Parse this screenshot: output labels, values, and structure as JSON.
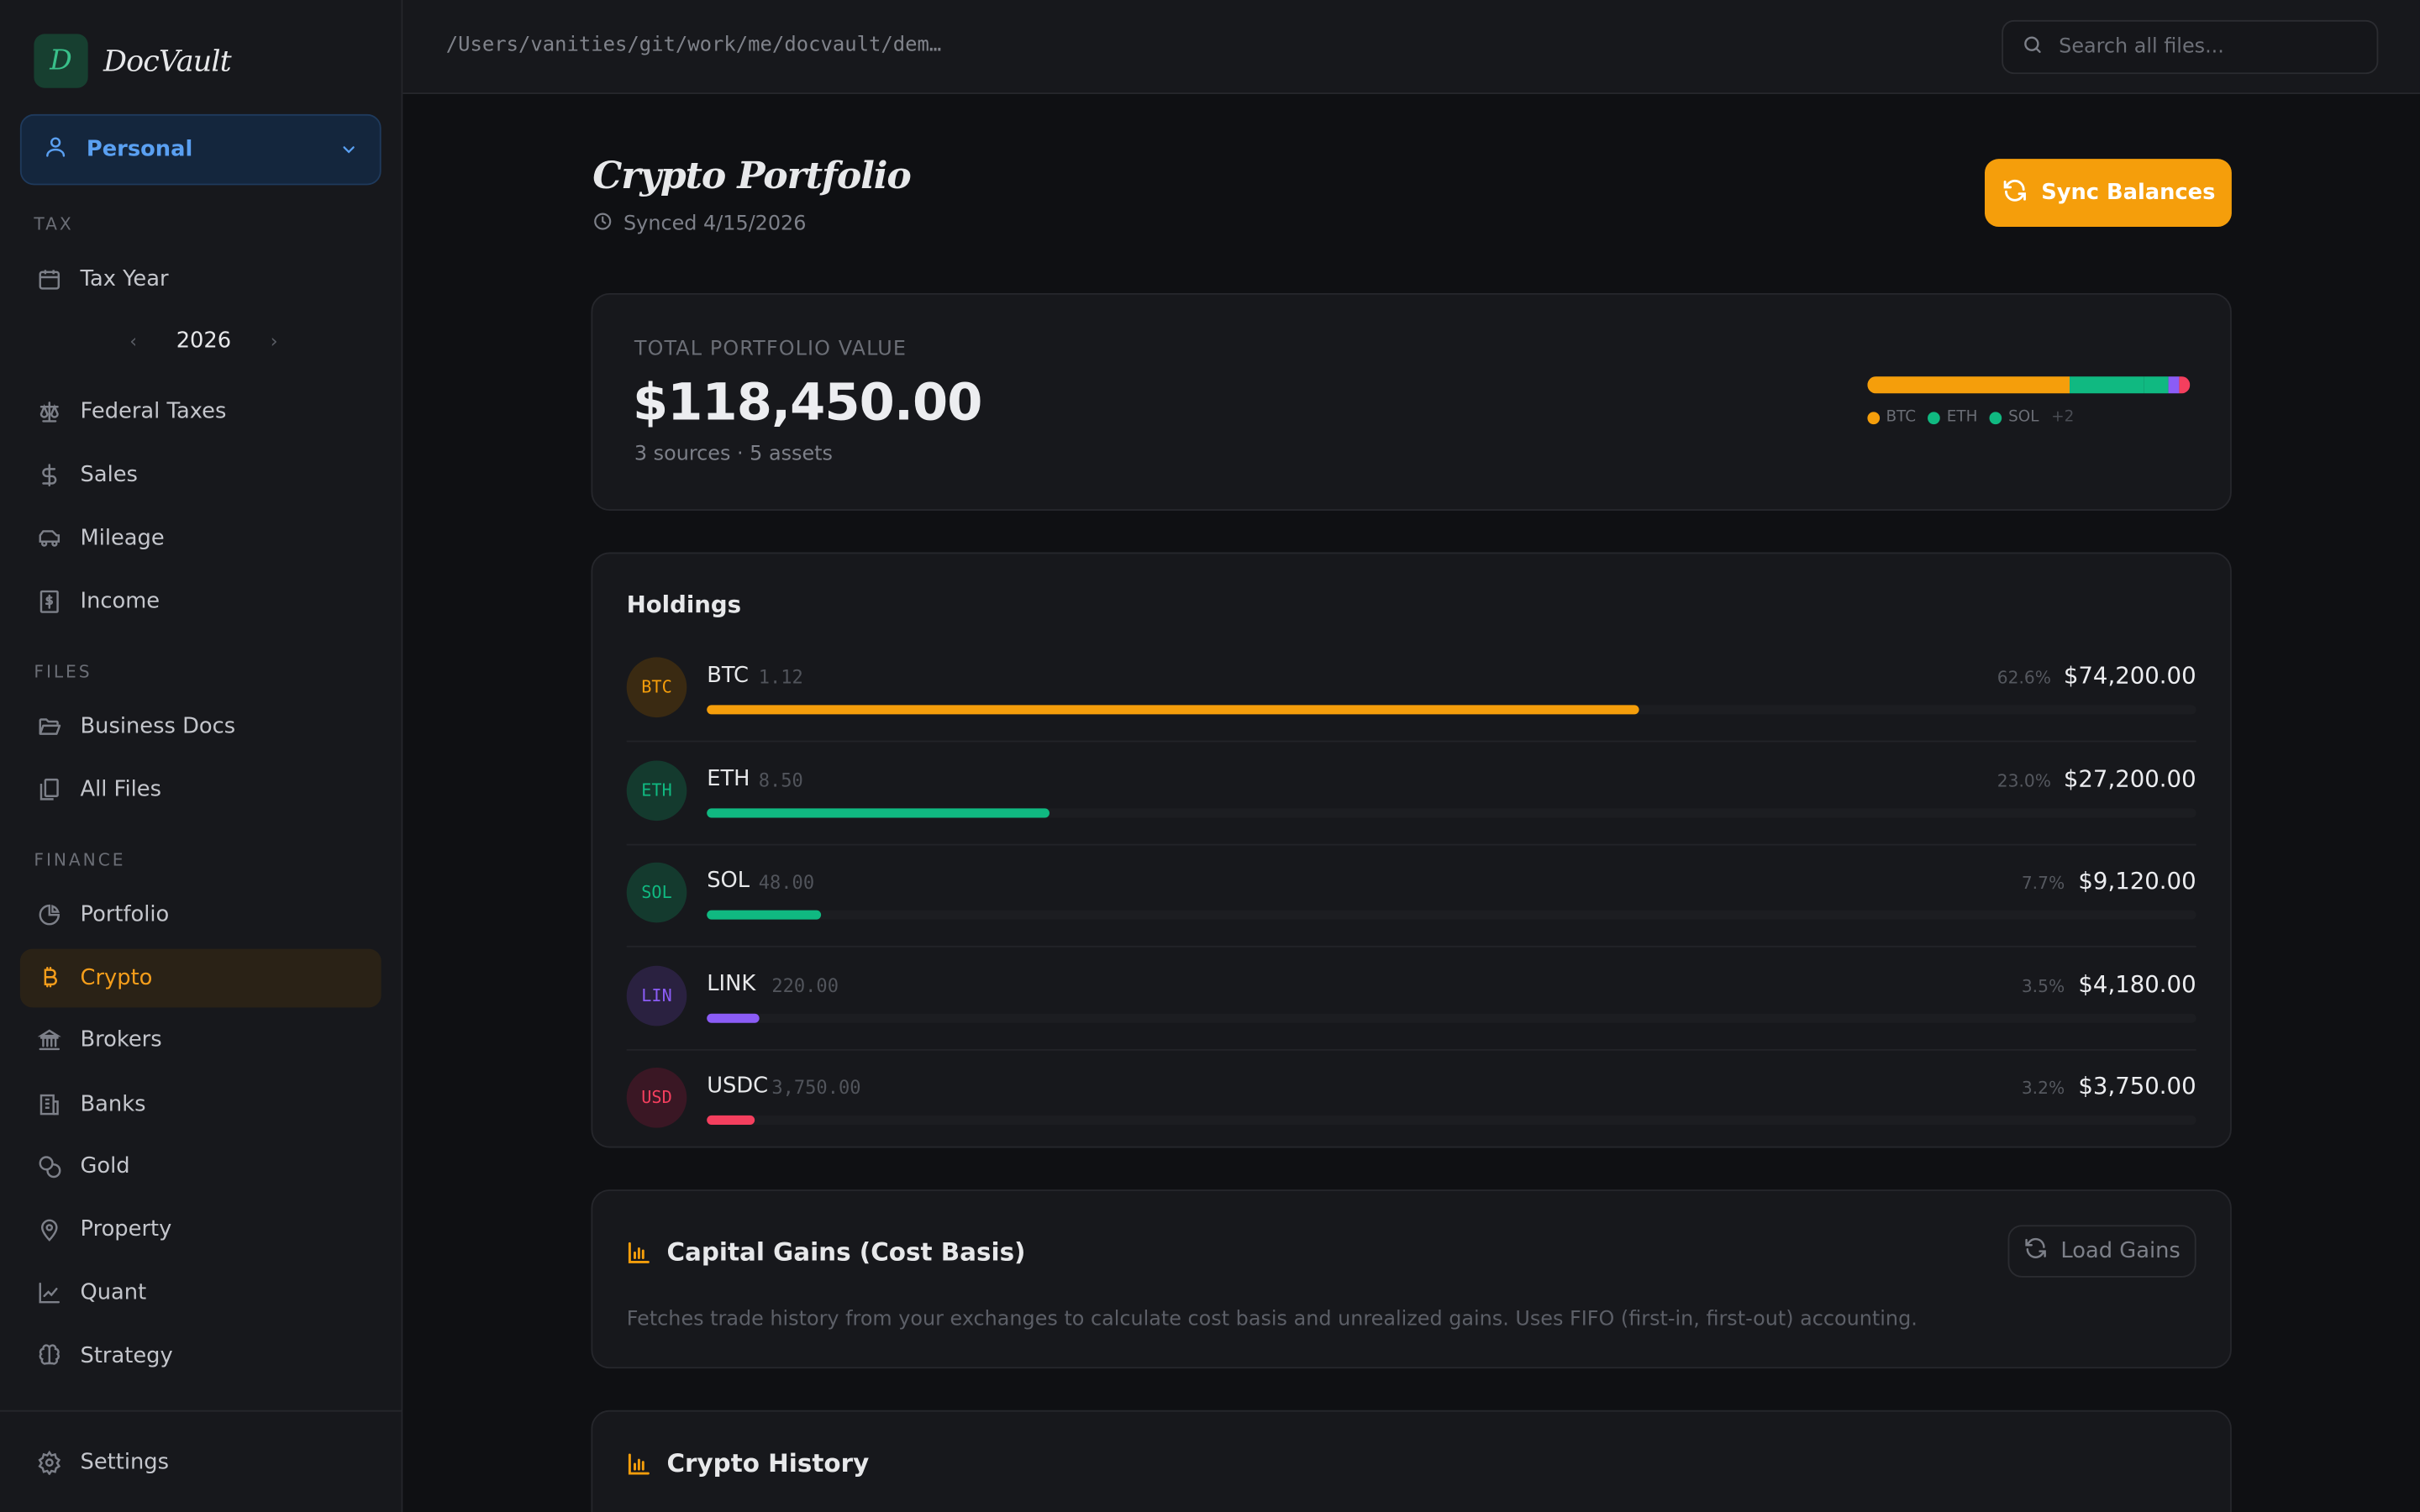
{
  "app": {
    "brand_letter": "D",
    "brand_name": "DocVault"
  },
  "profile": {
    "name": "Personal"
  },
  "sidebar": {
    "section_tax": "TAX",
    "tax_year_label": "Tax Year",
    "year": "2026",
    "tax_items": [
      {
        "label": "Federal Taxes",
        "icon": "scale-icon"
      },
      {
        "label": "Sales",
        "icon": "dollar-icon"
      },
      {
        "label": "Mileage",
        "icon": "car-icon"
      },
      {
        "label": "Income",
        "icon": "receipt-icon"
      }
    ],
    "section_files": "FILES",
    "file_items": [
      {
        "label": "Business Docs",
        "icon": "folder-open-icon"
      },
      {
        "label": "All Files",
        "icon": "files-icon"
      }
    ],
    "section_finance": "FINANCE",
    "finance_items": [
      {
        "label": "Portfolio",
        "icon": "pie-chart-icon"
      },
      {
        "label": "Crypto",
        "icon": "bitcoin-icon",
        "active": true
      },
      {
        "label": "Brokers",
        "icon": "landmark-icon"
      },
      {
        "label": "Banks",
        "icon": "building-icon"
      },
      {
        "label": "Gold",
        "icon": "coins-icon"
      },
      {
        "label": "Property",
        "icon": "map-pin-icon"
      },
      {
        "label": "Quant",
        "icon": "line-chart-icon"
      },
      {
        "label": "Strategy",
        "icon": "brain-icon"
      }
    ],
    "settings": "Settings"
  },
  "topbar": {
    "path": "/Users/vanities/git/work/me/docvault/dem…",
    "search_placeholder": "Search all files..."
  },
  "header": {
    "title": "Crypto Portfolio",
    "synced": "Synced 4/15/2026",
    "sync_button": "Sync Balances"
  },
  "summary": {
    "label": "TOTAL PORTFOLIO VALUE",
    "value": "$118,450.00",
    "sub": "3 sources · 5 assets",
    "legend": [
      {
        "name": "BTC",
        "color": "#f59e0b"
      },
      {
        "name": "ETH",
        "color": "#10b981"
      },
      {
        "name": "SOL",
        "color": "#10b981"
      }
    ],
    "legend_more": "+2"
  },
  "holdings": {
    "title": "Holdings",
    "rows": [
      {
        "badge": "BTC",
        "symbol": "BTC",
        "amount": "1.12",
        "pct": "62.6%",
        "value": "$74,200.00",
        "share": 0.626,
        "color": "#f59e0b",
        "badge_bg": "#3a2a12"
      },
      {
        "badge": "ETH",
        "symbol": "ETH",
        "amount": "8.50",
        "pct": "23.0%",
        "value": "$27,200.00",
        "share": 0.23,
        "color": "#10b981",
        "badge_bg": "#143a2e"
      },
      {
        "badge": "SOL",
        "symbol": "SOL",
        "amount": "48.00",
        "pct": "7.7%",
        "value": "$9,120.00",
        "share": 0.077,
        "color": "#10b981",
        "badge_bg": "#143a2e"
      },
      {
        "badge": "LIN",
        "symbol": "LINK",
        "amount": "220.00",
        "pct": "3.5%",
        "value": "$4,180.00",
        "share": 0.035,
        "color": "#8b5cf6",
        "badge_bg": "#2a2140"
      },
      {
        "badge": "USD",
        "symbol": "USDC",
        "amount": "3,750.00",
        "pct": "3.2%",
        "value": "$3,750.00",
        "share": 0.032,
        "color": "#f43f5e",
        "badge_bg": "#3a1724"
      }
    ]
  },
  "capital_gains": {
    "title": "Capital Gains (Cost Basis)",
    "button": "Load Gains",
    "description": "Fetches trade history from your exchanges to calculate cost basis and unrealized gains. Uses FIFO (first-in, first-out) accounting."
  },
  "history": {
    "title": "Crypto History"
  },
  "colors": {
    "accent": "#f59e0b",
    "link": "#5aa0f2",
    "positive": "#10b981"
  }
}
